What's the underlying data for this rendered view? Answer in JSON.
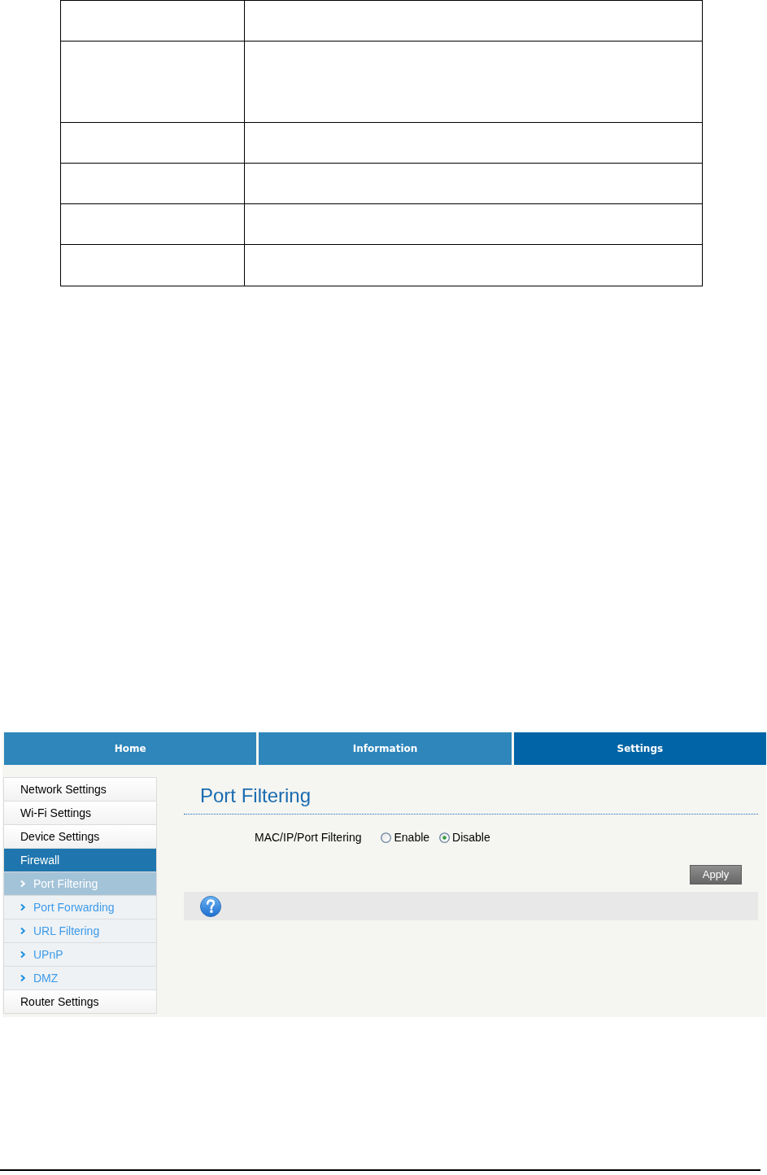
{
  "tabs": [
    {
      "label": "Home",
      "selected": false
    },
    {
      "label": "Information",
      "selected": false
    },
    {
      "label": "Settings",
      "selected": true
    }
  ],
  "sidebar": {
    "items": [
      {
        "label": "Network Settings",
        "selected": false
      },
      {
        "label": "Wi-Fi Settings",
        "selected": false
      },
      {
        "label": "Device Settings",
        "selected": false
      },
      {
        "label": "Firewall",
        "selected": true,
        "children": [
          {
            "label": "Port Filtering",
            "selected": true
          },
          {
            "label": "Port Forwarding",
            "selected": false
          },
          {
            "label": "URL Filtering",
            "selected": false
          },
          {
            "label": "UPnP",
            "selected": false
          },
          {
            "label": "DMZ",
            "selected": false
          }
        ]
      },
      {
        "label": "Router Settings",
        "selected": false
      }
    ]
  },
  "content": {
    "title": "Port Filtering",
    "setting": {
      "label": "MAC/IP/Port Filtering",
      "options": [
        {
          "label": "Enable",
          "selected": false
        },
        {
          "label": "Disable",
          "selected": true
        }
      ]
    },
    "apply_button": "Apply"
  }
}
